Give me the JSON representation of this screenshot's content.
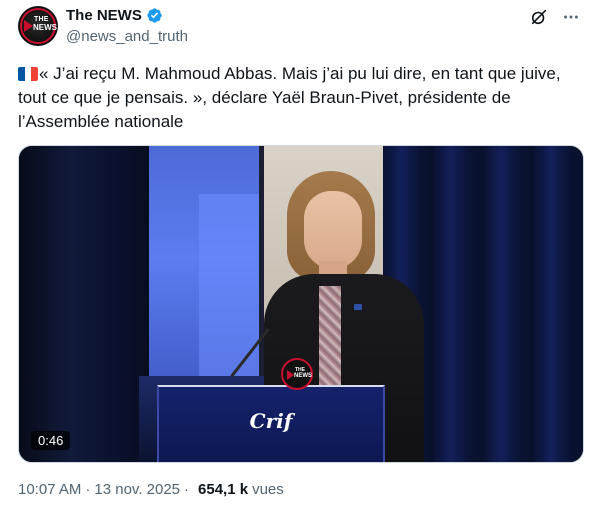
{
  "author": {
    "display_name": "The NEWS",
    "handle": "@news_and_truth",
    "verified": true,
    "avatar_text": {
      "line1": "THE",
      "line2": "NEWS"
    }
  },
  "tweet": {
    "flag": "france-flag-icon",
    "text": "« J’ai reçu M. Mahmoud Abbas. Mais j’ai pu lui dire, en tant que juive, tout ce que je pensais. », déclare Yaël Braun-Pivet, présidente de l’Assemblée nationale"
  },
  "media": {
    "duration": "0:46",
    "lectern_logo": "Crif",
    "watermark": {
      "line1": "THE",
      "line2": "NEWS"
    }
  },
  "footer": {
    "time": "10:07 AM",
    "separator": "·",
    "date": "13 nov. 2025",
    "views_count": "654,1 k",
    "views_label": "vues"
  },
  "icons": {
    "verified": "verified-badge-icon",
    "grok": "grok-icon",
    "more": "more-icon"
  },
  "colors": {
    "verified": "#1d9bf0",
    "secondary_text": "#536471",
    "brand_red": "#c8102e"
  }
}
